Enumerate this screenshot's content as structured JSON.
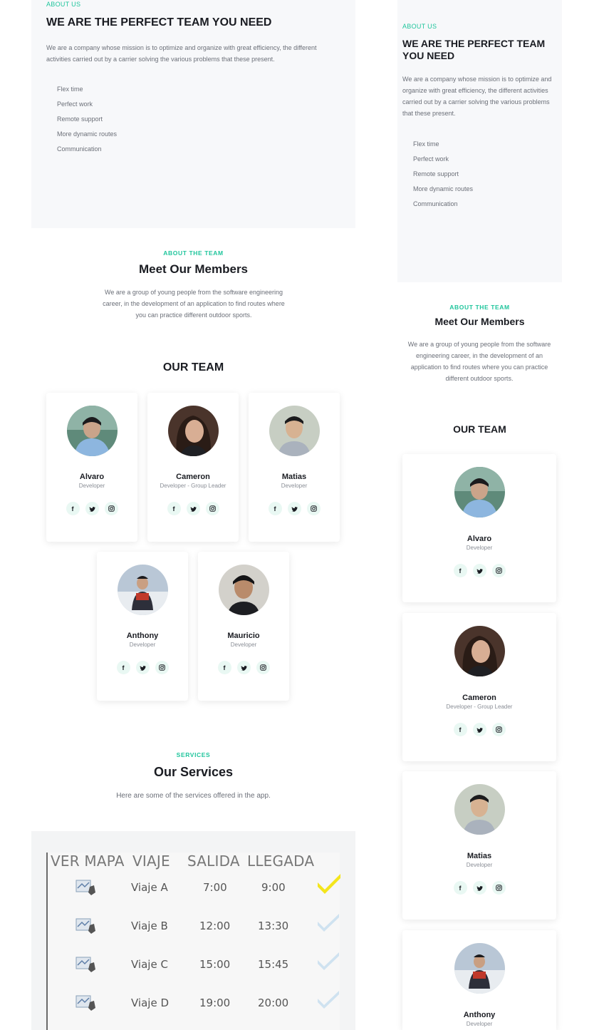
{
  "about": {
    "eyebrow": "ABOUT US",
    "title": "WE ARE THE PERFECT TEAM YOU NEED",
    "text": "We are a company whose mission is to optimize and organize with great efficiency, the different activities carried out by a carrier solving the various problems that these present.",
    "features": [
      "Flex time",
      "Perfect work",
      "Remote support",
      "More dynamic routes",
      "Communication"
    ]
  },
  "about_mobile": {
    "title_line1": "WE ARE THE PERFECT TEAM",
    "title_line2": "YOU NEED"
  },
  "team_section": {
    "eyebrow": "ABOUT THE TEAM",
    "title": "Meet Our Members",
    "text": "We are a group of young people from the software engineering career, in the development of an application to find routes where you can practice different outdoor sports.",
    "our_team": "OUR TEAM"
  },
  "members": [
    {
      "name": "Alvaro",
      "role": "Developer",
      "avatar": "avatar-alvaro"
    },
    {
      "name": "Cameron",
      "role": "Developer - Group Leader",
      "avatar": "avatar-cameron"
    },
    {
      "name": "Matias",
      "role": "Developer",
      "avatar": "avatar-matias"
    },
    {
      "name": "Anthony",
      "role": "Developer",
      "avatar": "avatar-anthony"
    },
    {
      "name": "Mauricio",
      "role": "Developer",
      "avatar": "avatar-mauricio"
    }
  ],
  "social_icons": [
    "facebook-icon",
    "twitter-icon",
    "instagram-icon"
  ],
  "services": {
    "eyebrow": "SERVICES",
    "title": "Our Services",
    "text": "Here are some of the services offered in the app."
  },
  "schedule": {
    "headers": [
      "VER MAPA",
      "VIAJE",
      "SALIDA",
      "LLEGADA"
    ],
    "rows": [
      {
        "trip": "Viaje A",
        "out": "7:00",
        "arr": "9:00",
        "selected": true
      },
      {
        "trip": "Viaje B",
        "out": "12:00",
        "arr": "13:30",
        "selected": false
      },
      {
        "trip": "Viaje C",
        "out": "15:00",
        "arr": "15:45",
        "selected": false
      },
      {
        "trip": "Viaje D",
        "out": "19:00",
        "arr": "20:00",
        "selected": false
      }
    ]
  },
  "colors": {
    "accent": "#1fc59c",
    "check_active": "#f4e51c",
    "check_inactive": "#cfe2f0"
  }
}
